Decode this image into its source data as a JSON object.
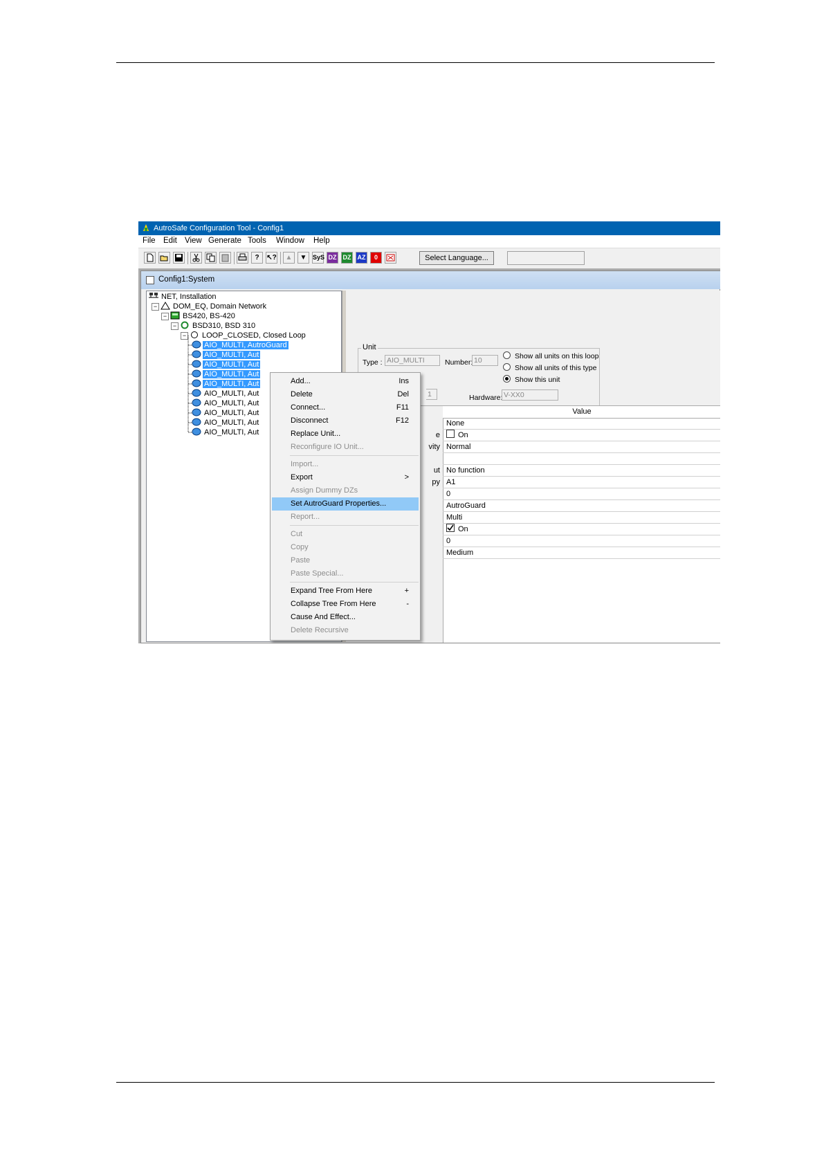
{
  "window": {
    "title": "AutroSafe Configuration Tool - Config1"
  },
  "menubar": [
    "File",
    "Edit",
    "View",
    "Generate",
    "Tools",
    "Window",
    "Help"
  ],
  "toolbar": {
    "buttons": [
      "new-icon",
      "open-icon",
      "save-icon",
      "cut-icon",
      "copy-icon",
      "paste-icon",
      "print-icon",
      "help-icon",
      "context-help-icon",
      "up-icon",
      "down-icon",
      "SyS",
      "DZ",
      "DZ",
      "AZ",
      "0",
      "close-icon"
    ],
    "select_language_label": "Select Language..."
  },
  "child_window": {
    "title": "Config1:System"
  },
  "tree": {
    "nodes": [
      {
        "label": "NET, Installation",
        "level": 0
      },
      {
        "label": "DOM_EQ, Domain Network",
        "level": 1
      },
      {
        "label": "BS420, BS-420",
        "level": 2
      },
      {
        "label": "BSD310, BSD 310",
        "level": 3
      },
      {
        "label": "LOOP_CLOSED, Closed Loop",
        "level": 4
      }
    ],
    "units": [
      {
        "label": "AIO_MULTI, AutroGuard",
        "selected": true
      },
      {
        "label": "AIO_MULTI, Aut",
        "selected": true
      },
      {
        "label": "AIO_MULTI, Aut",
        "selected": true
      },
      {
        "label": "AIO_MULTI, Aut",
        "selected": true
      },
      {
        "label": "AIO_MULTI, Aut",
        "selected": true
      },
      {
        "label": "AIO_MULTI, Aut",
        "selected": false
      },
      {
        "label": "AIO_MULTI, Aut",
        "selected": false
      },
      {
        "label": "AIO_MULTI, Aut",
        "selected": false
      },
      {
        "label": "AIO_MULTI, Aut",
        "selected": false
      },
      {
        "label": "AIO_MULTI, Aut",
        "selected": false
      }
    ]
  },
  "unit_panel": {
    "group_label": "Unit",
    "type_label": "Type :",
    "type_value": "AIO_MULTI",
    "number_label": "Number:",
    "number_value": "10",
    "hardware_label": "Hardware:",
    "hardware_value": "V-XX0",
    "partial_field": "1",
    "radios": [
      {
        "label": "Show all units on this loop",
        "checked": false
      },
      {
        "label": "Show all units of this type",
        "checked": false
      },
      {
        "label": "Show this unit",
        "checked": true
      }
    ]
  },
  "properties": {
    "value_header": "Value",
    "rows": [
      {
        "label": "",
        "value": "None"
      },
      {
        "label": "e",
        "value": "On",
        "checkbox": false
      },
      {
        "label": "vity",
        "value": "Normal"
      },
      {
        "label": "",
        "value": ""
      },
      {
        "label": "ut",
        "value": "No function"
      },
      {
        "label": "py",
        "value": "A1"
      },
      {
        "label": "",
        "value": "0"
      },
      {
        "label": "",
        "value": "AutroGuard"
      },
      {
        "label": "",
        "value": "Multi"
      },
      {
        "label": "",
        "value": "On",
        "checkbox": true
      },
      {
        "label": "",
        "value": "0"
      },
      {
        "label": "",
        "value": "Medium"
      }
    ]
  },
  "context_menu": {
    "items": [
      {
        "label": "Add...",
        "shortcut": "Ins",
        "disabled": false
      },
      {
        "label": "Delete",
        "shortcut": "Del",
        "disabled": false
      },
      {
        "label": "Connect...",
        "shortcut": "F11",
        "disabled": false
      },
      {
        "label": "Disconnect",
        "shortcut": "F12",
        "disabled": false
      },
      {
        "label": "Replace Unit...",
        "shortcut": "",
        "disabled": false
      },
      {
        "label": "Reconfigure IO Unit...",
        "shortcut": "",
        "disabled": true
      },
      {
        "label": "Import...",
        "shortcut": "",
        "disabled": true
      },
      {
        "label": "Export",
        "shortcut": ">",
        "disabled": false
      },
      {
        "label": "Assign Dummy DZs",
        "shortcut": "",
        "disabled": true
      },
      {
        "label": "Set AutroGuard Properties...",
        "shortcut": "",
        "disabled": false,
        "highlighted": true
      },
      {
        "label": "Report...",
        "shortcut": "",
        "disabled": true
      },
      {
        "label": "Cut",
        "shortcut": "",
        "disabled": true
      },
      {
        "label": "Copy",
        "shortcut": "",
        "disabled": true
      },
      {
        "label": "Paste",
        "shortcut": "",
        "disabled": true
      },
      {
        "label": "Paste Special...",
        "shortcut": "",
        "disabled": true
      },
      {
        "label": "Expand Tree From Here",
        "shortcut": "+",
        "disabled": false
      },
      {
        "label": "Collapse Tree From Here",
        "shortcut": "-",
        "disabled": false
      },
      {
        "label": "Cause And Effect...",
        "shortcut": "",
        "disabled": false
      },
      {
        "label": "Delete Recursive",
        "shortcut": "",
        "disabled": true
      }
    ]
  },
  "colors": {
    "titlebar": "#0063b1",
    "selection": "#3399ff",
    "menu_highlight": "#91c9f7"
  }
}
